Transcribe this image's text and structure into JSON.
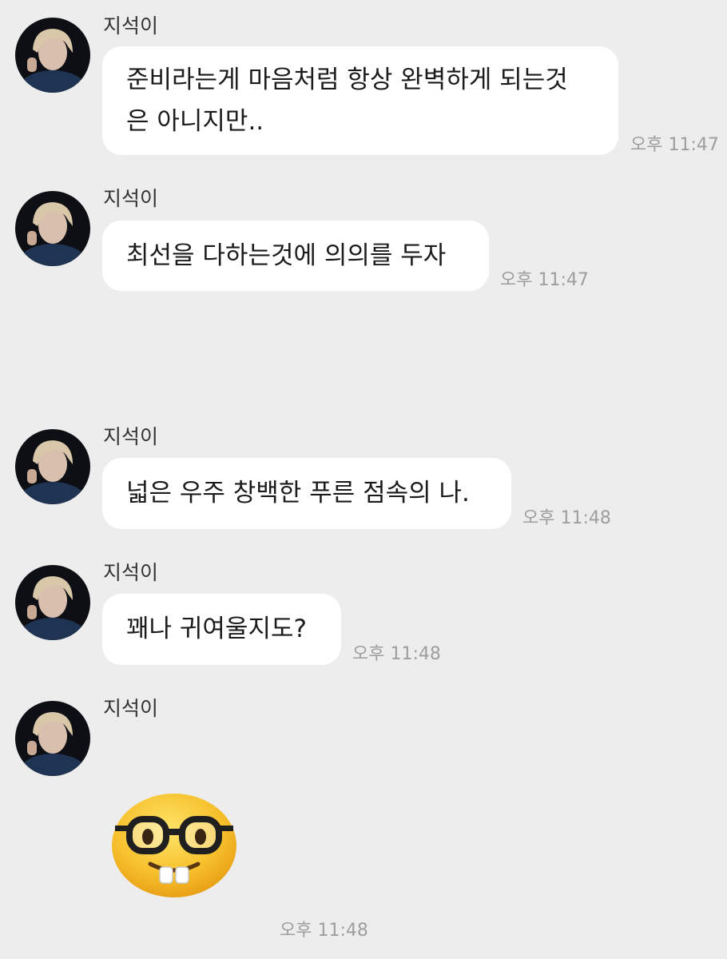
{
  "chat": {
    "sender_name": "지석이",
    "messages": [
      {
        "kind": "text",
        "lines": [
          "준비라는게 마음처럼 항상 완벽하게 되는것",
          "은 아니지만.."
        ],
        "time": "오후 11:47"
      },
      {
        "kind": "text",
        "lines": [
          "최선을 다하는것에 의의를 두자"
        ],
        "time": "오후 11:47"
      },
      {
        "kind": "text",
        "lines": [
          "넓은 우주 창백한 푸른 점속의 나."
        ],
        "time": "오후 11:48"
      },
      {
        "kind": "text",
        "lines": [
          "꽤나 귀여울지도?"
        ],
        "time": "오후 11:48"
      },
      {
        "kind": "emoji",
        "emoji_icon": "nerd-face-emoji",
        "time": "오후 11:48"
      }
    ]
  },
  "colors": {
    "background": "#ededed",
    "bubble": "#ffffff",
    "text": "#1b1b1b",
    "timestamp": "#9e9e9e"
  }
}
